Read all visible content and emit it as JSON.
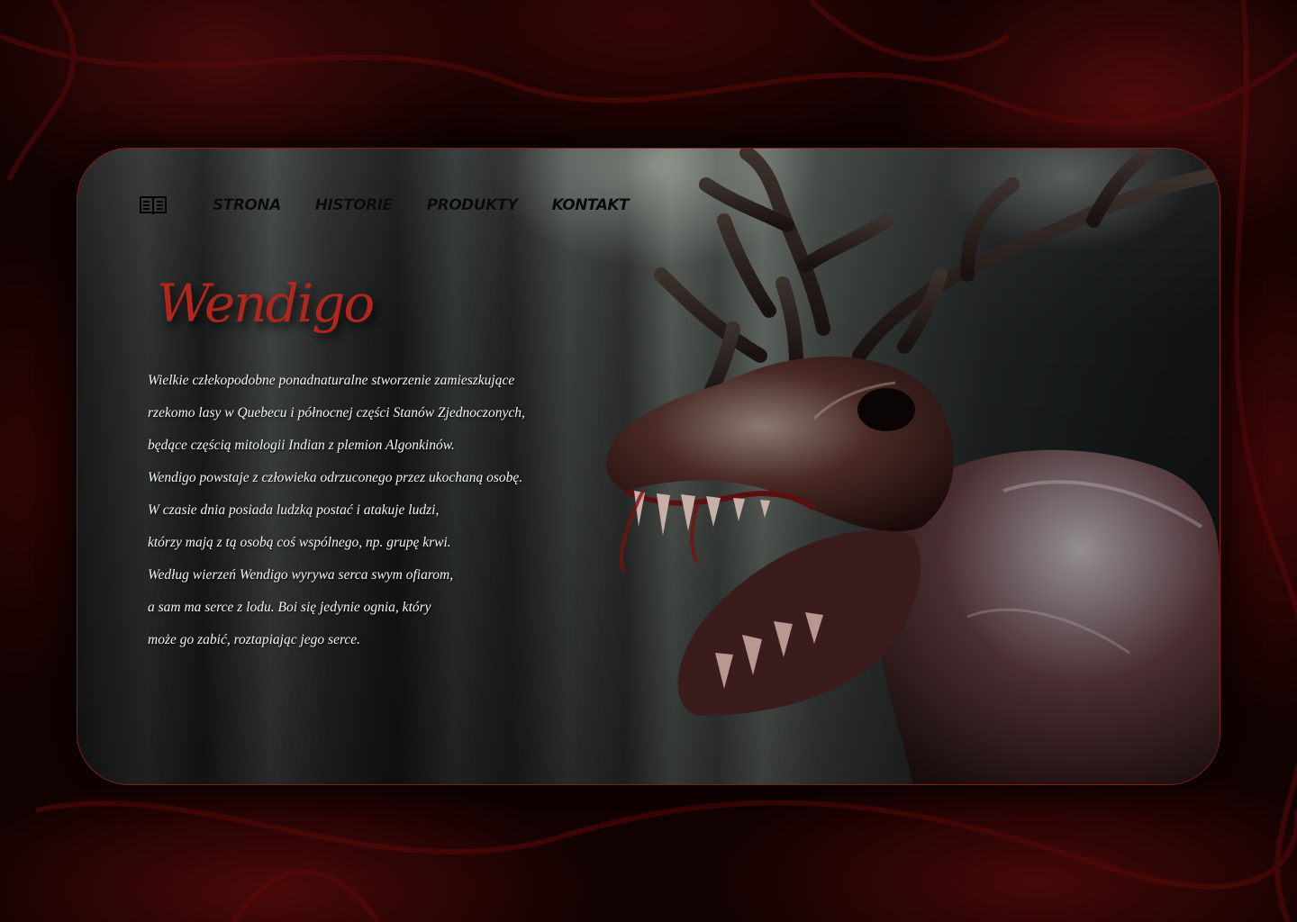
{
  "nav": {
    "links": [
      "STRONA",
      "HISTORIE",
      "PRODUKTY",
      "KONTAKT"
    ]
  },
  "hero": {
    "title": "Wendigo",
    "description_lines": [
      "Wielkie człekopodobne ponadnaturalne stworzenie zamieszkujące",
      "rzekomo lasy w Quebecu i północnej części Stanów Zjednoczonych,",
      "będące częścią mitologii Indian z plemion Algonkinów.",
      "Wendigo powstaje z człowieka odrzuconego przez ukochaną osobę.",
      "W czasie dnia posiada ludzką postać i atakuje ludzi,",
      "którzy mają z tą osobą coś wspólnego, np. grupę krwi.",
      "Według wierzeń Wendigo wyrywa serca swym ofiarom,",
      "a sam ma serce z lodu. Boi się jedynie ognia, który",
      "może go zabić, roztapiając jego serce."
    ]
  },
  "icons": {
    "logo": "open-book-icon",
    "hero_image": "wendigo-creature-image"
  },
  "colors": {
    "accent": "#b3261b",
    "border": "#8a1b14",
    "nav_text": "#0a0a0a",
    "body_text": "#f2f2f2"
  }
}
